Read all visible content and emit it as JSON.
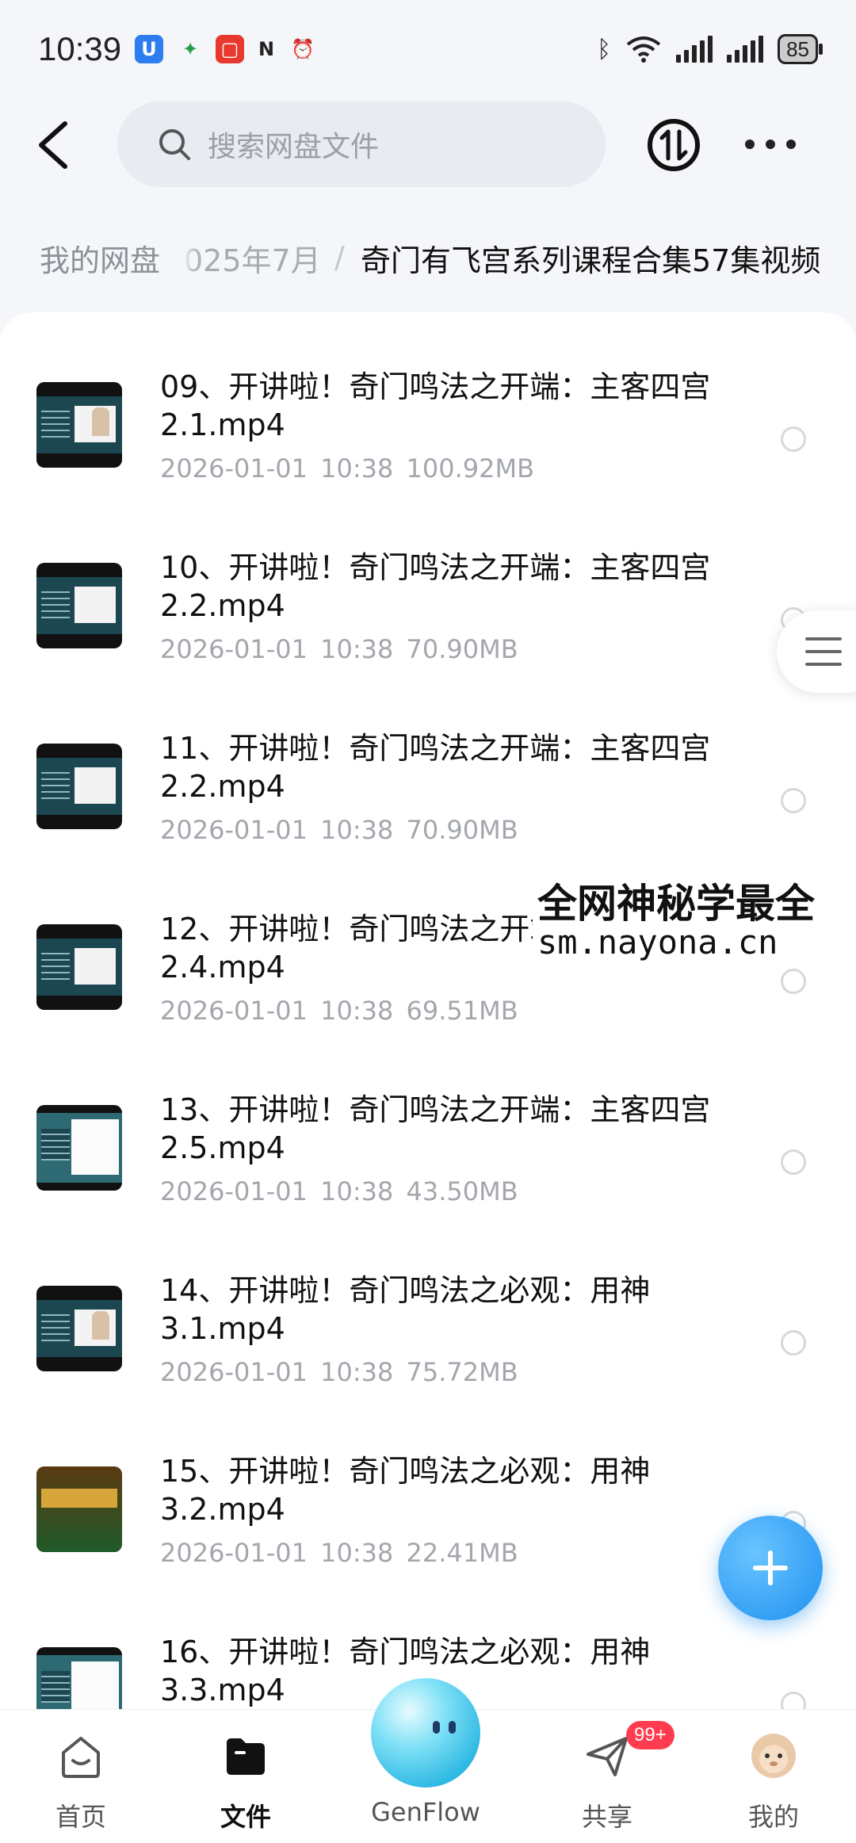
{
  "status_bar": {
    "time": "10:39",
    "battery": "85"
  },
  "header": {
    "search_placeholder": "搜索网盘文件"
  },
  "breadcrumb": {
    "root": "我的网盘",
    "middle": "025年7月",
    "separator": "/",
    "current": "奇门有飞宫系列课程合集57集视频"
  },
  "files": [
    {
      "name": "09、开讲啦！奇门鸣法之开端：主客四宫2.1.mp4",
      "date": "2026-01-01",
      "time": "10:38",
      "size": "100.92MB",
      "thumbnail": "video-lecture"
    },
    {
      "name": "10、开讲啦！奇门鸣法之开端：主客四宫2.2.mp4",
      "date": "2026-01-01",
      "time": "10:38",
      "size": "70.90MB",
      "thumbnail": "video-table"
    },
    {
      "name": "11、开讲啦！奇门鸣法之开端：主客四宫2.2.mp4",
      "date": "2026-01-01",
      "time": "10:38",
      "size": "70.90MB",
      "thumbnail": "video-table"
    },
    {
      "name": "12、开讲啦！奇门鸣法之开端：主客四宫2.4.mp4",
      "date": "2026-01-01",
      "time": "10:38",
      "size": "69.51MB",
      "thumbnail": "video-table"
    },
    {
      "name": "13、开讲啦！奇门鸣法之开端：主客四宫2.5.mp4",
      "date": "2026-01-01",
      "time": "10:38",
      "size": "43.50MB",
      "thumbnail": "video-slide"
    },
    {
      "name": "14、开讲啦！奇门鸣法之必观：用神3.1.mp4",
      "date": "2026-01-01",
      "time": "10:38",
      "size": "75.72MB",
      "thumbnail": "video-lecture"
    },
    {
      "name": "15、开讲啦！奇门鸣法之必观：用神3.2.mp4",
      "date": "2026-01-01",
      "time": "10:38",
      "size": "22.41MB",
      "thumbnail": "video-game"
    },
    {
      "name": "16、开讲啦！奇门鸣法之必观：用神3.3.mp4",
      "date": "",
      "time": "",
      "size": "",
      "thumbnail": "video-slide"
    }
  ],
  "watermark": {
    "line1": "全网神秘学最全",
    "line2": "sm.nayona.cn"
  },
  "bottom_nav": {
    "items": [
      {
        "label": "首页",
        "icon": "home-icon",
        "active": false
      },
      {
        "label": "文件",
        "icon": "folder-icon",
        "active": true
      },
      {
        "label": "GenFlow",
        "icon": "genflow-icon",
        "active": false
      },
      {
        "label": "共享",
        "icon": "share-plane-icon",
        "active": false
      },
      {
        "label": "我的",
        "icon": "avatar-icon",
        "active": false
      }
    ],
    "share_badge": "99+"
  },
  "colors": {
    "accent": "#1e90f0",
    "badge": "#ff3b4f",
    "text_secondary": "#a3a7ad"
  }
}
